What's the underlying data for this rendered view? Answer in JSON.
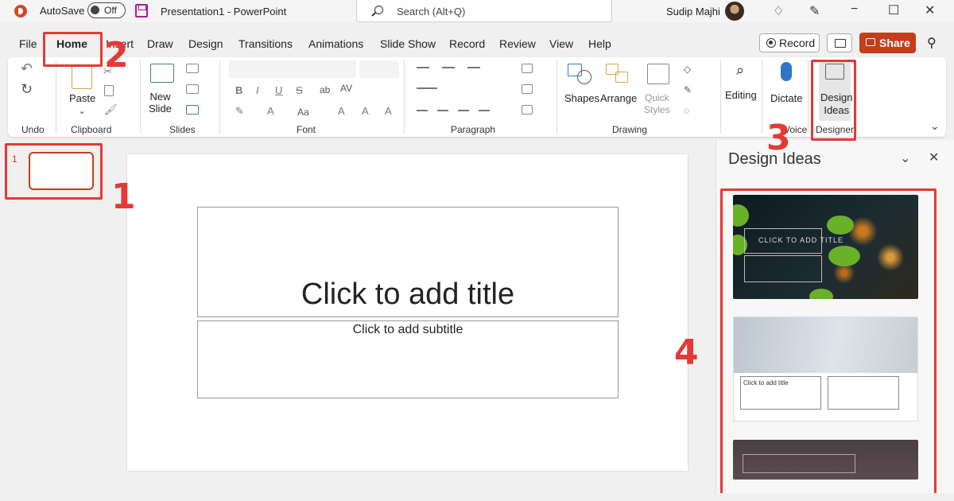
{
  "titlebar": {
    "autosave_label": "AutoSave",
    "autosave_state": "Off",
    "document": "Presentation1 - PowerPoint",
    "search_placeholder": "Search (Alt+Q)",
    "user": "Sudip Majhi",
    "minimize": "−",
    "maximize": "☐",
    "close": "✕"
  },
  "tabs": [
    "File",
    "Home",
    "Insert",
    "Draw",
    "Design",
    "Transitions",
    "Animations",
    "Slide Show",
    "Record",
    "Review",
    "View",
    "Help"
  ],
  "active_tab": "Home",
  "actions": {
    "record": "Record",
    "share": "Share"
  },
  "ribbon": {
    "undo_group": "Undo",
    "clipboard_group": "Clipboard",
    "paste": "Paste",
    "slides_group": "Slides",
    "new_slide": "New\nSlide",
    "font_group": "Font",
    "paragraph_group": "Paragraph",
    "drawing_group": "Drawing",
    "shapes": "Shapes",
    "arrange": "Arrange",
    "quick_styles": "Quick\nStyles",
    "editing": "Editing",
    "voice_group": "Voice",
    "dictate": "Dictate",
    "designer_group": "Designer",
    "design_ideas": "Design\nIdeas"
  },
  "thumbnails": [
    {
      "number": "1"
    }
  ],
  "slide": {
    "title_placeholder": "Click to add title",
    "subtitle_placeholder": "Click to add subtitle"
  },
  "design_pane": {
    "title": "Design Ideas",
    "idea1_text": "CLICK TO ADD TITLE",
    "idea2_text": "Click to add title"
  },
  "annotations": [
    "1",
    "2",
    "3",
    "4"
  ],
  "colors": {
    "accent": "#c43e1c",
    "annotation": "#e53935"
  }
}
